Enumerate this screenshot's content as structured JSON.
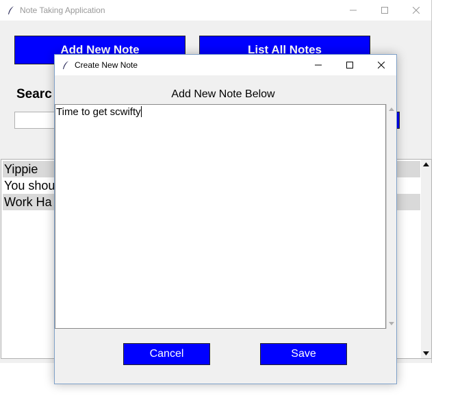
{
  "main_window": {
    "title": "Note Taking Application",
    "add_note_button": "Add New Note",
    "list_notes_button": "List All Notes",
    "search_label": "Searc",
    "search_value": "",
    "notes": [
      {
        "label": "Yippie",
        "selected": true
      },
      {
        "label": "You shou",
        "selected": false
      },
      {
        "label": "Work Ha",
        "selected": true
      }
    ]
  },
  "dialog": {
    "title": "Create New Note",
    "heading": "Add New Note Below",
    "note_text": "Time to get scwifty",
    "cancel_button": "Cancel",
    "save_button": "Save"
  },
  "colors": {
    "button_blue": "#0000ff",
    "selected_row": "#d9d9d9",
    "window_bg": "#f0f0f0"
  },
  "icons": [
    "feather-icon",
    "minimize-icon",
    "maximize-icon",
    "close-icon",
    "scroll-up-icon",
    "scroll-down-icon"
  ]
}
